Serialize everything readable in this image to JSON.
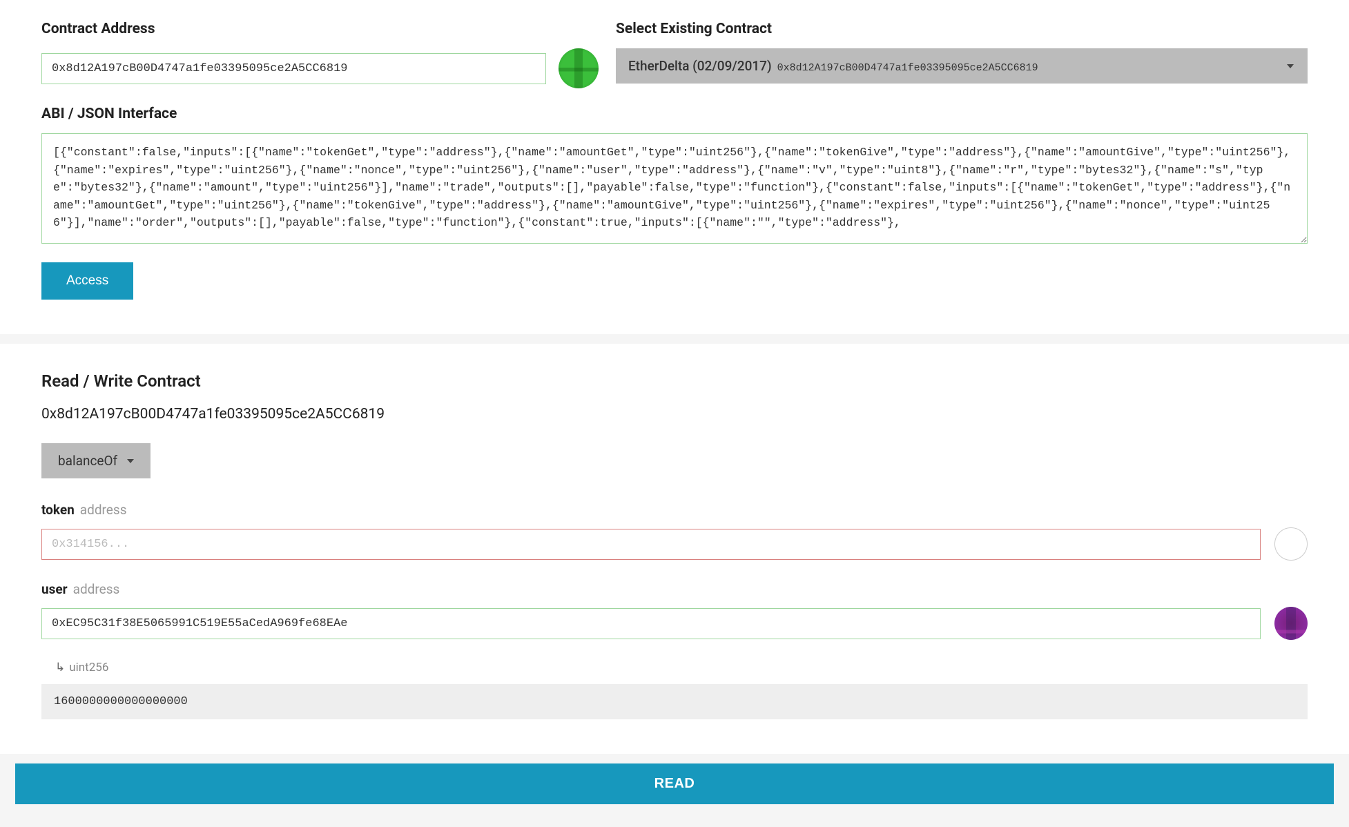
{
  "top": {
    "contract_address_label": "Contract Address",
    "contract_address_value": "0x8d12A197cB00D4747a1fe03395095ce2A5CC6819",
    "select_existing_label": "Select Existing Contract",
    "select_existing_name": "EtherDelta (02/09/2017)",
    "select_existing_addr": "0x8d12A197cB00D4747a1fe03395095ce2A5CC6819",
    "abi_label": "ABI / JSON Interface",
    "abi_value": "[{\"constant\":false,\"inputs\":[{\"name\":\"tokenGet\",\"type\":\"address\"},{\"name\":\"amountGet\",\"type\":\"uint256\"},{\"name\":\"tokenGive\",\"type\":\"address\"},{\"name\":\"amountGive\",\"type\":\"uint256\"},{\"name\":\"expires\",\"type\":\"uint256\"},{\"name\":\"nonce\",\"type\":\"uint256\"},{\"name\":\"user\",\"type\":\"address\"},{\"name\":\"v\",\"type\":\"uint8\"},{\"name\":\"r\",\"type\":\"bytes32\"},{\"name\":\"s\",\"type\":\"bytes32\"},{\"name\":\"amount\",\"type\":\"uint256\"}],\"name\":\"trade\",\"outputs\":[],\"payable\":false,\"type\":\"function\"},{\"constant\":false,\"inputs\":[{\"name\":\"tokenGet\",\"type\":\"address\"},{\"name\":\"amountGet\",\"type\":\"uint256\"},{\"name\":\"tokenGive\",\"type\":\"address\"},{\"name\":\"amountGive\",\"type\":\"uint256\"},{\"name\":\"expires\",\"type\":\"uint256\"},{\"name\":\"nonce\",\"type\":\"uint256\"}],\"name\":\"order\",\"outputs\":[],\"payable\":false,\"type\":\"function\"},{\"constant\":true,\"inputs\":[{\"name\":\"\",\"type\":\"address\"},",
    "access_button": "Access"
  },
  "rw": {
    "title": "Read / Write Contract",
    "address": "0x8d12A197cB00D4747a1fe03395095ce2A5CC6819",
    "function_selected": "balanceOf",
    "params": [
      {
        "name": "token",
        "type": "address",
        "placeholder": "0x314156...",
        "value": "",
        "valid": false
      },
      {
        "name": "user",
        "type": "address",
        "placeholder": "",
        "value": "0xEC95C31f38E5065991C519E55aCedA969fe68EAe",
        "valid": true
      }
    ],
    "output_type": "uint256",
    "output_value": "1600000000000000000",
    "read_button": "READ"
  }
}
